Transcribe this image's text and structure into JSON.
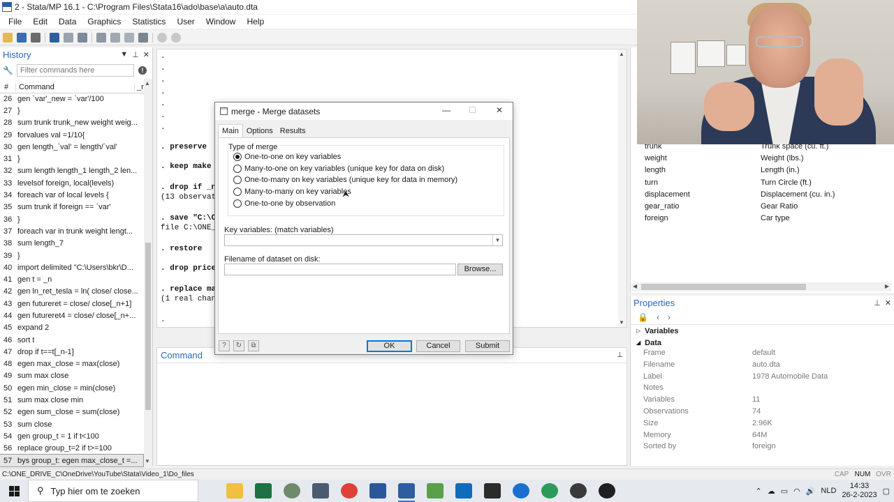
{
  "window": {
    "title": "2 - Stata/MP 16.1 - C:\\Program Files\\Stata16\\ado\\base\\a\\auto.dta"
  },
  "menu": [
    "File",
    "Edit",
    "Data",
    "Graphics",
    "Statistics",
    "User",
    "Window",
    "Help"
  ],
  "history": {
    "title": "History",
    "filter_placeholder": "Filter commands here",
    "col_num": "#",
    "col_command": "Command",
    "col_rc": "_rc",
    "selected_index": 30,
    "rows": [
      {
        "n": "26",
        "cmd": "gen `var'_new = `var'/100"
      },
      {
        "n": "27",
        "cmd": "}"
      },
      {
        "n": "28",
        "cmd": "sum trunk trunk_new weight weig..."
      },
      {
        "n": "29",
        "cmd": "forvalues val =1/10{"
      },
      {
        "n": "30",
        "cmd": "gen length_`val' = length/`val'"
      },
      {
        "n": "31",
        "cmd": "}"
      },
      {
        "n": "32",
        "cmd": "sum length length_1 length_2 len..."
      },
      {
        "n": "33",
        "cmd": "levelsof foreign, local(levels)"
      },
      {
        "n": "34",
        "cmd": "foreach var of local levels {"
      },
      {
        "n": "35",
        "cmd": "sum trunk if foreign == `var'"
      },
      {
        "n": "36",
        "cmd": "}"
      },
      {
        "n": "37",
        "cmd": "foreach var in trunk weight lengt..."
      },
      {
        "n": "38",
        "cmd": "sum length_7"
      },
      {
        "n": "39",
        "cmd": "}"
      },
      {
        "n": "40",
        "cmd": "import delimited \"C:\\Users\\bkr\\D..."
      },
      {
        "n": "41",
        "cmd": "gen t = _n"
      },
      {
        "n": "42",
        "cmd": "gen ln_ret_tesla = ln( close/ close..."
      },
      {
        "n": "43",
        "cmd": "gen futureret = close/ close[_n+1]"
      },
      {
        "n": "44",
        "cmd": "gen futureret4 = close/ close[_n+..."
      },
      {
        "n": "45",
        "cmd": "expand 2"
      },
      {
        "n": "46",
        "cmd": "sort t"
      },
      {
        "n": "47",
        "cmd": "drop if t==t[_n-1]"
      },
      {
        "n": "48",
        "cmd": "egen max_close = max(close)"
      },
      {
        "n": "49",
        "cmd": "sum max close"
      },
      {
        "n": "50",
        "cmd": "egen min_close = min(close)"
      },
      {
        "n": "51",
        "cmd": "sum max close min"
      },
      {
        "n": "52",
        "cmd": "egen sum_close = sum(close)"
      },
      {
        "n": "53",
        "cmd": "sum close"
      },
      {
        "n": "54",
        "cmd": "gen group_t = 1 if t<100"
      },
      {
        "n": "56",
        "cmd": "replace group_t=2 if t>=100"
      },
      {
        "n": "57",
        "cmd": "bys group_t: egen max_close_t =..."
      }
    ]
  },
  "results": {
    "lines": [
      {
        "text": ".",
        "bold": false
      },
      {
        "text": ".",
        "bold": false
      },
      {
        "text": ".",
        "bold": false
      },
      {
        "text": ".",
        "bold": false
      },
      {
        "text": ".",
        "bold": false
      },
      {
        "text": ".",
        "bold": false
      },
      {
        "text": ".",
        "bold": false
      },
      {
        "text": ". preserve",
        "bold": true
      },
      {
        "text": ". keep make p",
        "bold": true
      },
      {
        "text": ". drop if _n<",
        "bold": true
      },
      {
        "text": "(13 observati",
        "bold": false
      },
      {
        "text": ". save \"C:\\ON",
        "bold": true
      },
      {
        "text": "file C:\\ONE_D",
        "bold": false
      },
      {
        "text": ". restore",
        "bold": true
      },
      {
        "text": ". drop price",
        "bold": true
      },
      {
        "text": ". replace mak",
        "bold": true
      },
      {
        "text": "(1 real chang",
        "bold": false
      },
      {
        "text": ".",
        "bold": false
      }
    ]
  },
  "command_pane": {
    "title": "Command"
  },
  "variables": {
    "rows": [
      {
        "name": "trunk",
        "label": "Trunk space (cu. ft.)"
      },
      {
        "name": "weight",
        "label": "Weight (lbs.)"
      },
      {
        "name": "length",
        "label": "Length (in.)"
      },
      {
        "name": "turn",
        "label": "Turn Circle (ft.)"
      },
      {
        "name": "displacement",
        "label": "Displacement (cu. in.)"
      },
      {
        "name": "gear_ratio",
        "label": "Gear Ratio"
      },
      {
        "name": "foreign",
        "label": "Car type"
      }
    ]
  },
  "properties": {
    "title": "Properties",
    "section_variables": "Variables",
    "section_data": "Data",
    "rows": [
      {
        "key": "Frame",
        "value": "default"
      },
      {
        "key": "Filename",
        "value": "auto.dta"
      },
      {
        "key": "Label",
        "value": "1978 Automobile Data"
      },
      {
        "key": "Notes",
        "value": ""
      },
      {
        "key": "Variables",
        "value": "11"
      },
      {
        "key": "Observations",
        "value": "74"
      },
      {
        "key": "Size",
        "value": "2.96K"
      },
      {
        "key": "Memory",
        "value": "64M"
      },
      {
        "key": "Sorted by",
        "value": "foreign"
      }
    ]
  },
  "dialog": {
    "title": "merge - Merge datasets",
    "tabs": [
      "Main",
      "Options",
      "Results"
    ],
    "group_label": "Type of merge",
    "options": [
      "One-to-one on key variables",
      "Many-to-one on key variables (unique key for data on disk)",
      "One-to-many on key variables (unique key for data in memory)",
      "Many-to-many on key variables",
      "One-to-one by observation"
    ],
    "selected_option": 0,
    "key_vars_label": "Key variables: (match variables)",
    "filename_label": "Filename of dataset on disk:",
    "browse_label": "Browse...",
    "ok_label": "OK",
    "cancel_label": "Cancel",
    "submit_label": "Submit"
  },
  "statusbar": {
    "path": "C:\\ONE_DRIVE_C\\OneDrive\\YouTube\\Stata\\Video_1\\Do_files",
    "flags": [
      "CAP",
      "NUM",
      "OVR"
    ]
  },
  "taskbar": {
    "search_placeholder": "Typ hier om te zoeken",
    "language": "NLD",
    "time": "14:33",
    "date": "26-2-2023"
  }
}
